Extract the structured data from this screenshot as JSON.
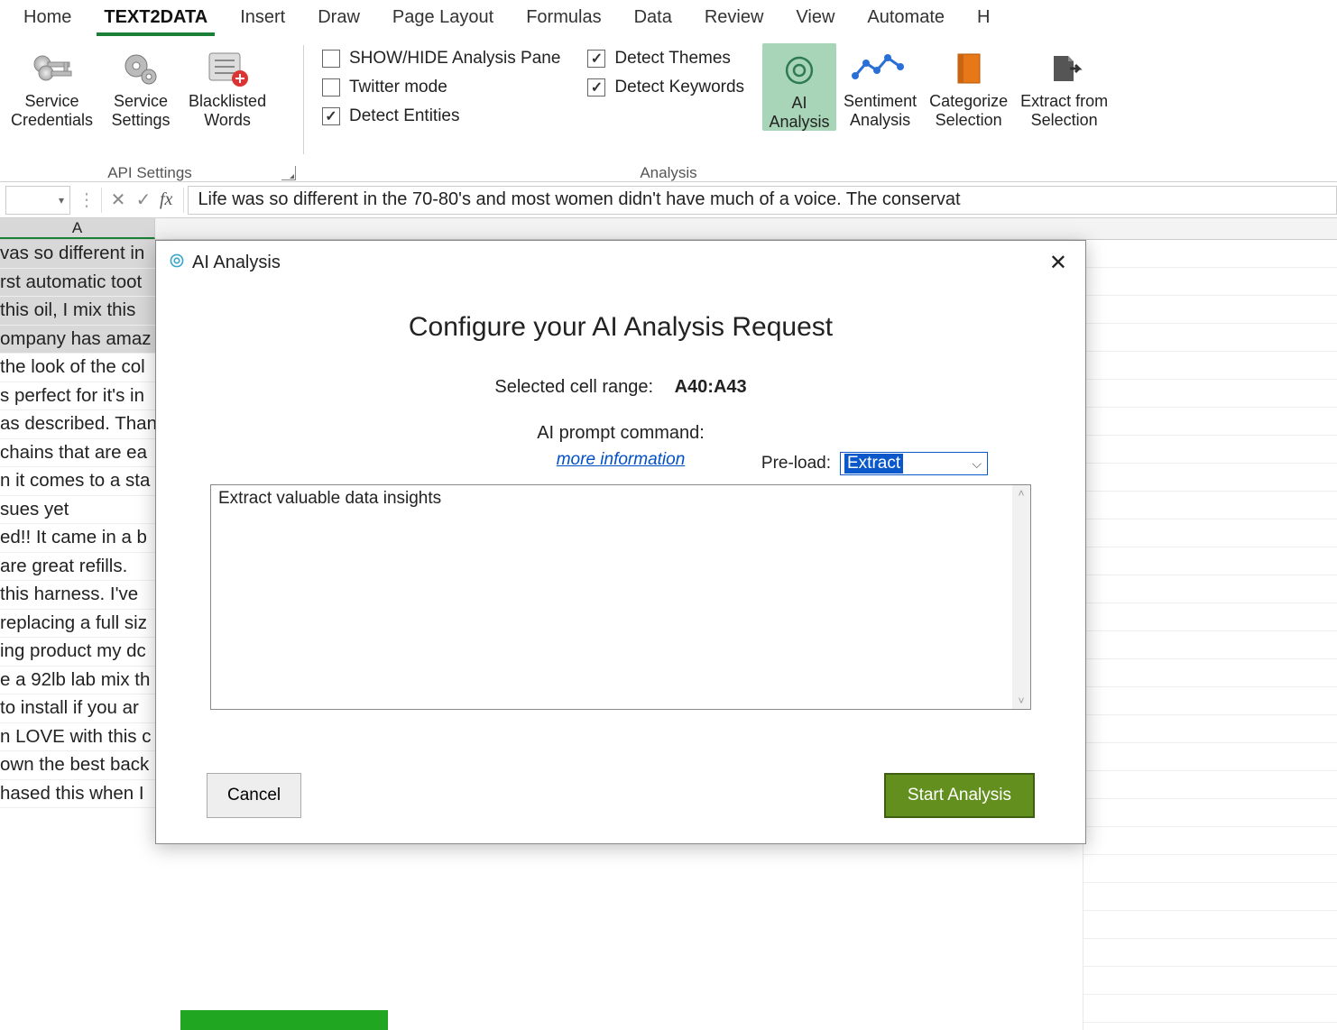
{
  "tabs": {
    "home": "Home",
    "text2data": "TEXT2DATA",
    "insert": "Insert",
    "draw": "Draw",
    "pagelayout": "Page Layout",
    "formulas": "Formulas",
    "data": "Data",
    "review": "Review",
    "view": "View",
    "automate": "Automate",
    "h": "H"
  },
  "ribbon": {
    "api_settings_group": "API Settings",
    "analysis_group": "Analysis",
    "service_credentials": "Service\nCredentials",
    "service_settings": "Service\nSettings",
    "blacklisted_words": "Blacklisted\nWords",
    "show_hide_pane": "SHOW/HIDE Analysis Pane",
    "twitter_mode": "Twitter mode",
    "detect_entities": "Detect Entities",
    "detect_themes": "Detect Themes",
    "detect_keywords": "Detect Keywords",
    "ai_analysis": "AI\nAnalysis",
    "sentiment_analysis": "Sentiment\nAnalysis",
    "categorize_selection": "Categorize\nSelection",
    "extract_from_selection": "Extract from\nSelection"
  },
  "formula_bar": {
    "fx": "fx",
    "text": "Life was so different in the 70-80's and most women didn't have much of a voice. The conservat"
  },
  "columns": {
    "A": "A"
  },
  "rows": [
    "vas so different in",
    "rst automatic toot",
    " this oil, I mix this",
    "ompany has amaz",
    "the look of the col",
    "s perfect for it's in",
    "as described. Than",
    "chains that are ea",
    "n it comes to a sta",
    "sues yet",
    "ed!! It came in a b",
    " are great refills. ",
    " this harness. I've",
    "replacing a full siz",
    "ing product my dc",
    "e a 92lb lab mix th",
    "to install if you ar",
    "n LOVE with this c",
    "own the best back",
    "hased this when I"
  ],
  "dialog": {
    "title": "AI Analysis",
    "heading": "Configure your AI Analysis Request",
    "range_label": "Selected cell range:",
    "range_value": "A40:A43",
    "prompt_label": "AI prompt command:",
    "more_info": "more information",
    "preload_label": "Pre-load:",
    "preload_value": "Extract",
    "prompt_text": "Extract valuable data insights",
    "cancel": "Cancel",
    "start": "Start Analysis"
  }
}
